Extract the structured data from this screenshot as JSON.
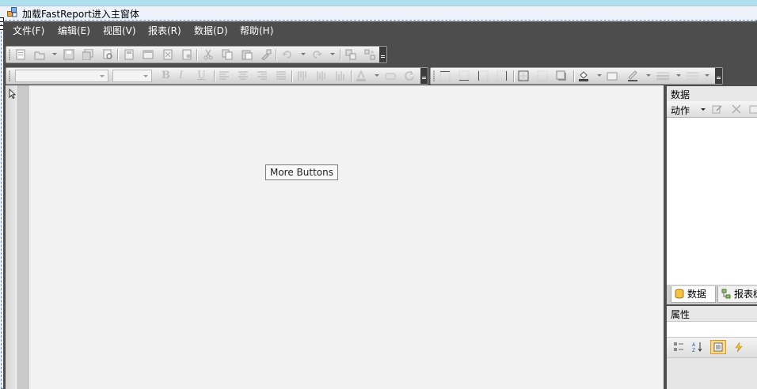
{
  "window": {
    "title": "加载FastReport进入主窗体"
  },
  "menu": {
    "items": [
      {
        "label": "文件(F)"
      },
      {
        "label": "编辑(E)"
      },
      {
        "label": "视图(V)"
      },
      {
        "label": "报表(R)"
      },
      {
        "label": "数据(D)"
      },
      {
        "label": "帮助(H)"
      }
    ]
  },
  "canvas": {
    "more_buttons_label": "More Buttons"
  },
  "data_panel": {
    "title": "数据",
    "actions_label": "动作"
  },
  "panel_tabs": [
    {
      "label": "数据"
    },
    {
      "label": "报表树"
    }
  ],
  "properties_panel": {
    "title": "属性"
  },
  "colors": {
    "desktop": "#aee0ec",
    "designer_background": "#4d4d4d",
    "toolbar": "#d9d9d9",
    "canvas": "#f2f2f2"
  },
  "icons": {
    "standard_toolbar": [
      "new-report-icon",
      "open-icon",
      "save-icon",
      "save-all-icon",
      "preview-icon",
      "new-page-icon",
      "new-dialog-icon",
      "delete-page-icon",
      "page-setup-icon",
      "cut-icon",
      "copy-icon",
      "paste-icon",
      "format-painter-icon",
      "undo-icon",
      "redo-icon",
      "group-icon",
      "ungroup-icon"
    ],
    "text_toolbar": [
      "bold-icon",
      "italic-icon",
      "underline-icon",
      "align-left-icon",
      "align-center-icon",
      "align-right-icon",
      "justify-icon",
      "align-top-icon",
      "align-middle-icon",
      "align-bottom-icon",
      "font-color-icon",
      "highlight-icon",
      "rotate-icon"
    ],
    "border_toolbar": [
      "border-top-icon",
      "border-bottom-icon",
      "border-left-icon",
      "border-right-icon",
      "border-all-icon",
      "border-none-icon",
      "border-shadow-icon",
      "fill-color-icon",
      "fill-icon",
      "line-color-icon",
      "line-width-icon",
      "line-style-icon"
    ],
    "property_toolbar": [
      "categorized-icon",
      "alphabetical-icon",
      "properties-icon",
      "events-icon"
    ]
  }
}
